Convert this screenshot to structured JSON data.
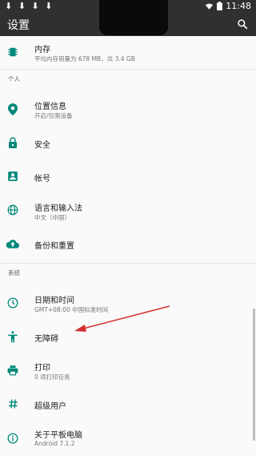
{
  "status_bar": {
    "notifications": "⬇ ⬇ ⬇ ⬇",
    "time": "11:48"
  },
  "app_bar": {
    "title": "设置",
    "search_icon": "search-icon"
  },
  "colors": {
    "accent": "#00897B",
    "toolbar": "#303030",
    "annotation_arrow": "#D32F2F"
  },
  "items_top": [
    {
      "id": "storage",
      "title": "内存",
      "subtitle": "平均内存用量为 678 MB，共 3.4 GB",
      "icon": "memory-chip-icon"
    }
  ],
  "sections": [
    {
      "label": "个人",
      "items": [
        {
          "id": "location",
          "title": "位置信息",
          "subtitle": "开启/仅限设备",
          "icon": "location-pin-icon"
        },
        {
          "id": "security",
          "title": "安全",
          "subtitle": "",
          "icon": "lock-icon"
        },
        {
          "id": "accounts",
          "title": "帐号",
          "subtitle": "",
          "icon": "account-box-icon"
        },
        {
          "id": "language",
          "title": "语言和输入法",
          "subtitle": "中文（中国）",
          "icon": "globe-icon"
        },
        {
          "id": "backup",
          "title": "备份和重置",
          "subtitle": "",
          "icon": "cloud-upload-icon"
        }
      ]
    },
    {
      "label": "系统",
      "items": [
        {
          "id": "datetime",
          "title": "日期和时间",
          "subtitle": "GMT+08:00 中国标准时间",
          "icon": "clock-icon"
        },
        {
          "id": "accessibility",
          "title": "无障碍",
          "subtitle": "",
          "icon": "accessibility-icon"
        },
        {
          "id": "print",
          "title": "打印",
          "subtitle": "0 项打印任务",
          "icon": "printer-icon"
        },
        {
          "id": "superuser",
          "title": "超级用户",
          "subtitle": "",
          "icon": "hash-icon"
        },
        {
          "id": "about",
          "title": "关于平板电脑",
          "subtitle": "Android 7.1.2",
          "icon": "info-icon"
        }
      ]
    }
  ]
}
